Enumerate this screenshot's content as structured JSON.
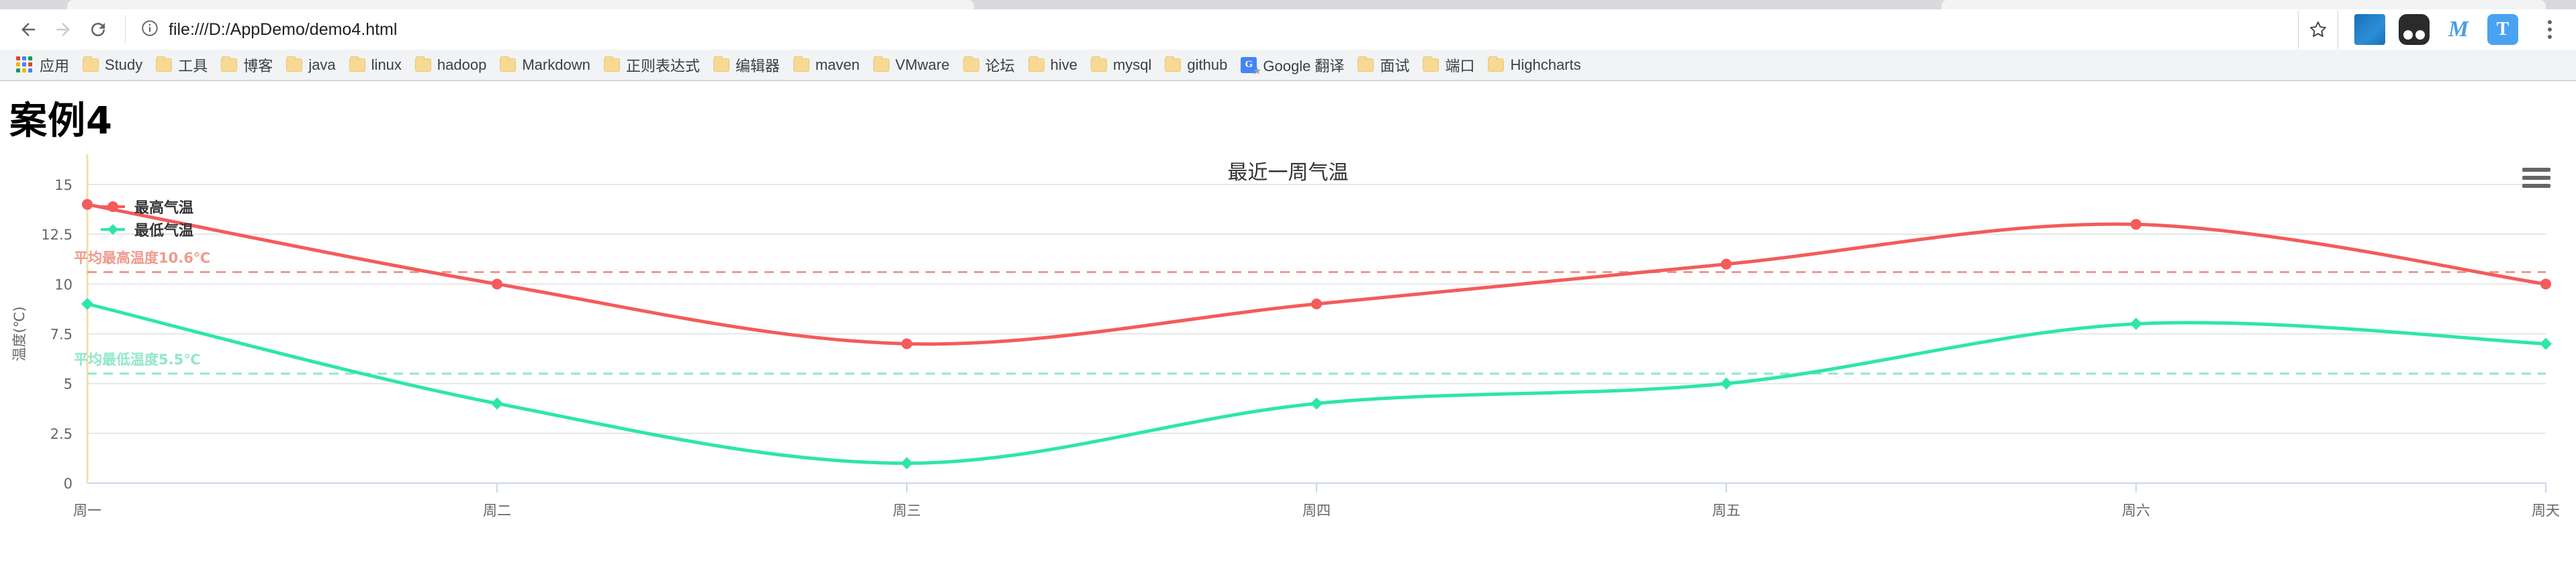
{
  "browser": {
    "url": "file:///D:/AppDemo/demo4.html",
    "nav": {
      "back_label": "Back",
      "forward_label": "Forward",
      "reload_label": "Reload"
    },
    "icons": {
      "info": "info-icon",
      "star": "bookmark-star-icon",
      "kebab": "chrome-menu-icon"
    },
    "extensions": [
      {
        "name": "extension-blue-box",
        "glyph": ""
      },
      {
        "name": "extension-dark-eyes",
        "glyph": ""
      },
      {
        "name": "extension-m",
        "glyph": "M"
      },
      {
        "name": "extension-t",
        "glyph": "T"
      }
    ],
    "bookmarks": [
      {
        "label": "应用",
        "icon": "apps-grid-icon"
      },
      {
        "label": "Study",
        "icon": "folder-icon"
      },
      {
        "label": "工具",
        "icon": "folder-icon"
      },
      {
        "label": "博客",
        "icon": "folder-icon"
      },
      {
        "label": "java",
        "icon": "folder-icon"
      },
      {
        "label": "linux",
        "icon": "folder-icon"
      },
      {
        "label": "hadoop",
        "icon": "folder-icon"
      },
      {
        "label": "Markdown",
        "icon": "folder-icon"
      },
      {
        "label": "正则表达式",
        "icon": "folder-icon"
      },
      {
        "label": "编辑器",
        "icon": "folder-icon"
      },
      {
        "label": "maven",
        "icon": "folder-icon"
      },
      {
        "label": "VMware",
        "icon": "folder-icon"
      },
      {
        "label": "论坛",
        "icon": "folder-icon"
      },
      {
        "label": "hive",
        "icon": "folder-icon"
      },
      {
        "label": "mysql",
        "icon": "folder-icon"
      },
      {
        "label": "github",
        "icon": "folder-icon"
      },
      {
        "label": "Google 翻译",
        "icon": "google-translate-icon"
      },
      {
        "label": "面试",
        "icon": "folder-icon"
      },
      {
        "label": "端口",
        "icon": "folder-icon"
      },
      {
        "label": "Highcharts",
        "icon": "folder-icon"
      }
    ]
  },
  "page": {
    "title": "案例4"
  },
  "chart_data": {
    "type": "line",
    "title": "最近一周气温",
    "xlabel": "",
    "ylabel": "温度(℃)",
    "categories": [
      "周一",
      "周二",
      "周三",
      "周四",
      "周五",
      "周六",
      "周天"
    ],
    "yticks": [
      "0",
      "2.5",
      "5",
      "7.5",
      "10",
      "12.5",
      "15"
    ],
    "ylim": [
      0,
      15
    ],
    "grid": true,
    "legend_position": "top-left",
    "series": [
      {
        "name": "最高气温",
        "color": "#f45b5b",
        "marker": "circle",
        "values": [
          14,
          10,
          7,
          9,
          11,
          13,
          10
        ]
      },
      {
        "name": "最低气温",
        "color": "#2ee6a8",
        "marker": "diamond",
        "values": [
          9,
          4,
          1,
          4,
          5,
          8,
          7
        ]
      }
    ],
    "plot_lines": [
      {
        "label": "平均最高温度10.6℃",
        "value": 10.6,
        "color": "#f1998e"
      },
      {
        "label": "平均最低温度5.5℃",
        "value": 5.5,
        "color": "#8fe8c8"
      }
    ],
    "crosshair": {
      "category": "周一",
      "color": "#f5dfa8"
    },
    "context_menu_label": "图表菜单"
  }
}
